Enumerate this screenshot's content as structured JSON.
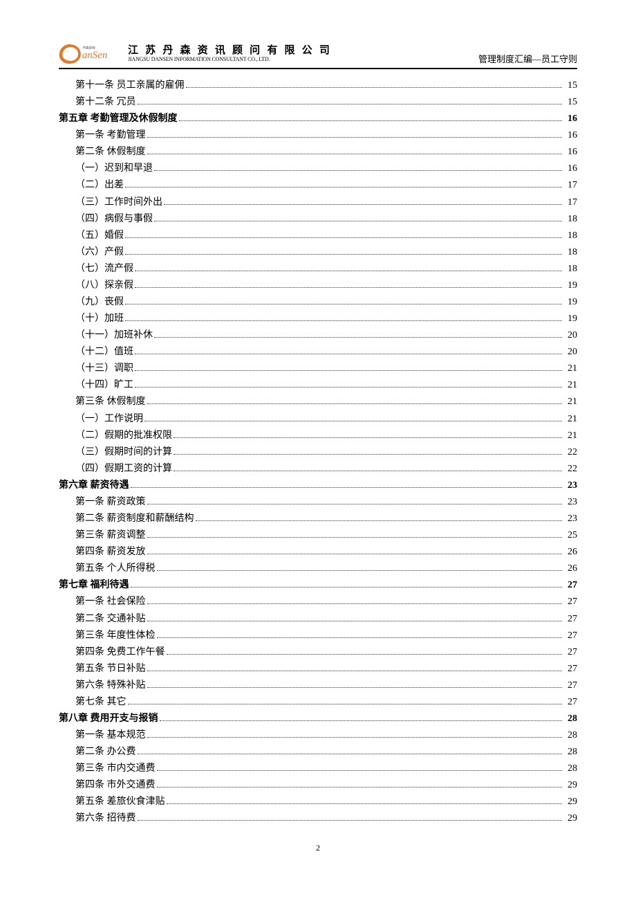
{
  "header": {
    "company_cn": "江 苏 丹 森 资 讯 顾 问 有 限 公 司",
    "company_en": "JIANGSU DANSEN INFORMATION CONSULTANT CO., LTD.",
    "doc_title": "管理制度汇编—员工守则"
  },
  "toc": [
    {
      "level": 1,
      "title": "第十一条 员工亲属的雇佣",
      "page": "15"
    },
    {
      "level": 1,
      "title": "第十二条 冗员",
      "page": "15"
    },
    {
      "level": 0,
      "title": "第五章 考勤管理及休假制度",
      "page": "16"
    },
    {
      "level": 1,
      "title": "第一条 考勤管理",
      "page": "16"
    },
    {
      "level": 1,
      "title": "第二条 休假制度",
      "page": "16"
    },
    {
      "level": 2,
      "title": "（一）迟到和早退",
      "page": "16"
    },
    {
      "level": 2,
      "title": "（二）出差",
      "page": "17"
    },
    {
      "level": 2,
      "title": "（三）工作时间外出",
      "page": "17"
    },
    {
      "level": 2,
      "title": "（四）病假与事假",
      "page": "18"
    },
    {
      "level": 2,
      "title": "（五）婚假",
      "page": "18"
    },
    {
      "level": 2,
      "title": "（六）产假",
      "page": "18"
    },
    {
      "level": 2,
      "title": "（七）流产假",
      "page": "18"
    },
    {
      "level": 2,
      "title": "（八）探亲假",
      "page": "19"
    },
    {
      "level": 2,
      "title": "（九）丧假",
      "page": "19"
    },
    {
      "level": 2,
      "title": "（十）加班",
      "page": "19"
    },
    {
      "level": 2,
      "title": "（十一）加班补休",
      "page": "20"
    },
    {
      "level": 2,
      "title": "（十二）值班",
      "page": "20"
    },
    {
      "level": 2,
      "title": "（十三）调职",
      "page": "21"
    },
    {
      "level": 2,
      "title": "（十四）旷工",
      "page": "21"
    },
    {
      "level": 1,
      "title": "第三条 休假制度",
      "page": "21"
    },
    {
      "level": 2,
      "title": "（一）工作说明",
      "page": "21"
    },
    {
      "level": 2,
      "title": "（二）假期的批准权限",
      "page": "21"
    },
    {
      "level": 2,
      "title": "（三）假期时间的计算",
      "page": "22"
    },
    {
      "level": 2,
      "title": "（四）假期工资的计算",
      "page": "22"
    },
    {
      "level": 0,
      "title": "第六章 薪资待遇",
      "page": "23"
    },
    {
      "level": 1,
      "title": "第一条 薪资政策",
      "page": "23"
    },
    {
      "level": 1,
      "title": "第二条 薪资制度和薪酬结构",
      "page": "23"
    },
    {
      "level": 1,
      "title": "第三条 薪资调整",
      "page": "25"
    },
    {
      "level": 1,
      "title": "第四条 薪资发放",
      "page": "26"
    },
    {
      "level": 1,
      "title": "第五条 个人所得税",
      "page": "26"
    },
    {
      "level": 0,
      "title": "第七章 福利待遇",
      "page": "27"
    },
    {
      "level": 1,
      "title": "第一条 社会保险",
      "page": "27"
    },
    {
      "level": 1,
      "title": "第二条 交通补贴",
      "page": "27"
    },
    {
      "level": 1,
      "title": "第三条 年度性体检",
      "page": "27"
    },
    {
      "level": 1,
      "title": "第四条 免费工作午餐",
      "page": "27"
    },
    {
      "level": 1,
      "title": "第五条 节日补贴",
      "page": "27"
    },
    {
      "level": 1,
      "title": "第六条 特殊补贴",
      "page": "27"
    },
    {
      "level": 1,
      "title": "第七条 其它",
      "page": "27"
    },
    {
      "level": 0,
      "title": "第八章 费用开支与报销",
      "page": "28"
    },
    {
      "level": 1,
      "title": "第一条 基本规范",
      "page": "28"
    },
    {
      "level": 1,
      "title": "第二条 办公费",
      "page": "28"
    },
    {
      "level": 1,
      "title": "第三条 市内交通费",
      "page": "28"
    },
    {
      "level": 1,
      "title": "第四条 市外交通费",
      "page": "29"
    },
    {
      "level": 1,
      "title": "第五条 差旅伙食津贴",
      "page": "29"
    },
    {
      "level": 1,
      "title": "第六条 招待费",
      "page": "29"
    }
  ],
  "page_number": "2"
}
